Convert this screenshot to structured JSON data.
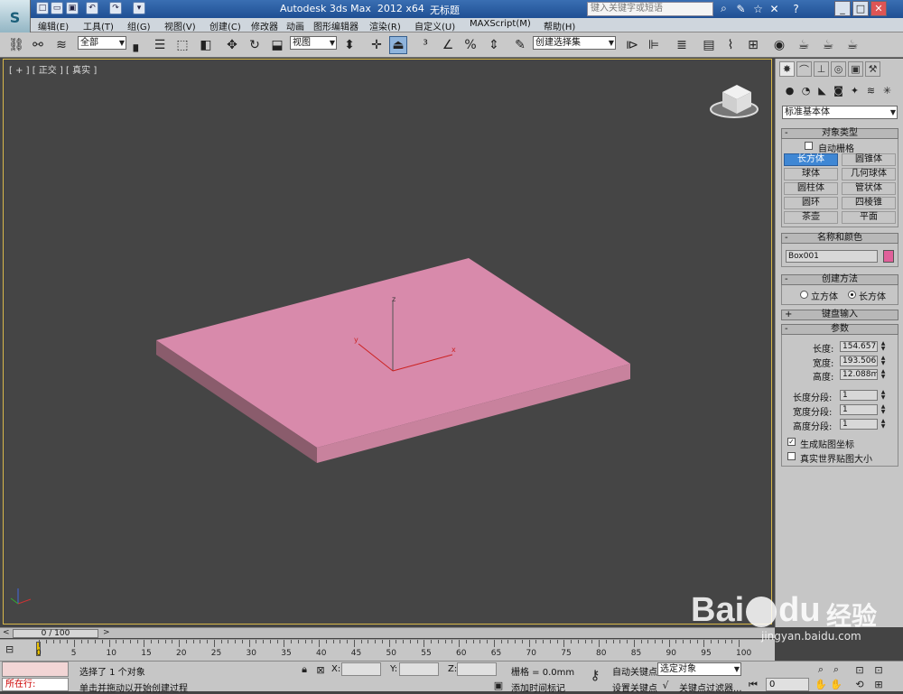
{
  "titlebar": {
    "title": "Autodesk 3ds Max  2012 x64",
    "file": "无标题",
    "search_placeholder": "键入关键字或短语"
  },
  "menu": [
    "编辑(E)",
    "工具(T)",
    "组(G)",
    "视图(V)",
    "创建(C)",
    "修改器",
    "动画",
    "图形编辑器",
    "渲染(R)",
    "自定义(U)",
    "MAXScript(M)",
    "帮助(H)"
  ],
  "toolbar": {
    "selection_filter": "全部",
    "ref_coord": "视图",
    "named_selection": "创建选择集"
  },
  "viewport": {
    "label": "[ + ] [ 正交 ] [ 真实 ]",
    "object_color": "#d88aab",
    "axis_x": "x",
    "axis_y": "y",
    "axis_z": "z"
  },
  "panel": {
    "category": "标准基本体",
    "object_type_title": "对象类型",
    "autogrid": "自动栅格",
    "buttons": [
      "长方体",
      "圆锥体",
      "球体",
      "几何球体",
      "圆柱体",
      "管状体",
      "圆环",
      "四棱锥",
      "茶壶",
      "平面"
    ],
    "selected_button": "长方体",
    "name_color_title": "名称和颜色",
    "object_name": "Box001",
    "swatch_color": "#e0609a",
    "creation_method_title": "创建方法",
    "method_cube": "立方体",
    "method_box": "长方体",
    "keyboard_title": "键盘输入",
    "params_title": "参数",
    "length_label": "长度:",
    "length": "154.657m",
    "width_label": "宽度:",
    "width": "193.506m",
    "height_label": "高度:",
    "height": "12.088mm",
    "length_segs_label": "长度分段:",
    "length_segs": "1",
    "width_segs_label": "宽度分段:",
    "width_segs": "1",
    "height_segs_label": "高度分段:",
    "height_segs": "1",
    "gen_mapping": "生成贴图坐标",
    "real_world": "真实世界贴图大小"
  },
  "timeline": {
    "slider": "0 / 100",
    "ticks": [
      "0",
      "5",
      "10",
      "15",
      "20",
      "25",
      "30",
      "35",
      "40",
      "45",
      "50",
      "55",
      "60",
      "65",
      "70",
      "75",
      "80",
      "85",
      "90",
      "95",
      "100"
    ]
  },
  "status": {
    "prompt_left": "所在行:",
    "selected": "选择了 1 个对象",
    "hint": "单击并拖动以开始创建过程",
    "x_label": "X:",
    "y_label": "Y:",
    "z_label": "Z:",
    "grid": "栅格 = 0.0mm",
    "add_time_tag": "添加时间标记",
    "auto_key": "自动关键点",
    "set_key": "设置关键点",
    "selected_obj": "选定对象",
    "key_filters": "关键点过滤器...",
    "frame": "0"
  },
  "watermark": {
    "brand": "Bai",
    "brand2": "du",
    "text": "经验",
    "url": "jingyan.baidu.com"
  }
}
